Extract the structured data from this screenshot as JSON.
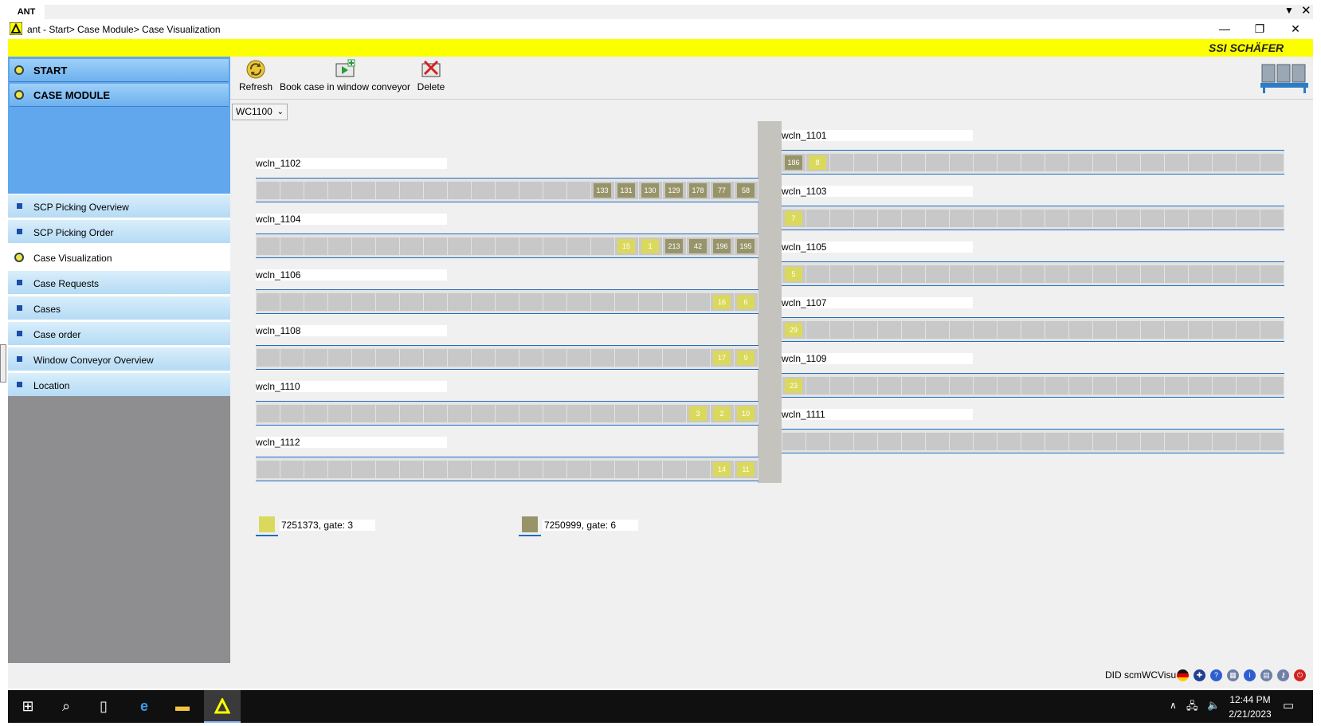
{
  "window": {
    "tab_label": "ANT",
    "title": "ant - Start> Case Module> Case Visualization",
    "menu_glyph": "▼",
    "close_glyph": "✕",
    "minimize_glyph": "—",
    "restore_glyph": "❐"
  },
  "brand": {
    "logo_prefix": "SSI",
    "logo_text": "SCHÄFER",
    "accent": "#fcff00"
  },
  "sidebar": {
    "headers": [
      {
        "label": "START"
      },
      {
        "label": "CASE MODULE"
      }
    ],
    "items": [
      {
        "label": "SCP Picking Overview",
        "active": false
      },
      {
        "label": "SCP Picking Order",
        "active": false
      },
      {
        "label": "Case Visualization",
        "active": true
      },
      {
        "label": "Case Requests",
        "active": false
      },
      {
        "label": "Cases",
        "active": false
      },
      {
        "label": "Case order",
        "active": false
      },
      {
        "label": "Window Conveyor Overview",
        "active": false
      },
      {
        "label": "Location",
        "active": false
      }
    ]
  },
  "toolbar": {
    "refresh_label": "Refresh",
    "book_label": "Book case in window conveyor",
    "delete_label": "Delete"
  },
  "selector": {
    "value": "WC1100"
  },
  "lanes": {
    "left": [
      {
        "name": "wcln_1102",
        "cases": [
          {
            "id": "133",
            "c": "g"
          },
          {
            "id": "131",
            "c": "g"
          },
          {
            "id": "130",
            "c": "g"
          },
          {
            "id": "129",
            "c": "g"
          },
          {
            "id": "178",
            "c": "g"
          },
          {
            "id": "77",
            "c": "g"
          },
          {
            "id": "58",
            "c": "g"
          }
        ]
      },
      {
        "name": "wcln_1104",
        "cases": [
          {
            "id": "15",
            "c": "y"
          },
          {
            "id": "1",
            "c": "y"
          },
          {
            "id": "213",
            "c": "g"
          },
          {
            "id": "42",
            "c": "g"
          },
          {
            "id": "196",
            "c": "g"
          },
          {
            "id": "195",
            "c": "g"
          }
        ]
      },
      {
        "name": "wcln_1106",
        "cases": [
          {
            "id": "16",
            "c": "y"
          },
          {
            "id": "6",
            "c": "y"
          }
        ]
      },
      {
        "name": "wcln_1108",
        "cases": [
          {
            "id": "17",
            "c": "y"
          },
          {
            "id": "9",
            "c": "y"
          }
        ]
      },
      {
        "name": "wcln_1110",
        "cases": [
          {
            "id": "3",
            "c": "y"
          },
          {
            "id": "2",
            "c": "y"
          },
          {
            "id": "10",
            "c": "y"
          }
        ]
      },
      {
        "name": "wcln_1112",
        "cases": [
          {
            "id": "14",
            "c": "y"
          },
          {
            "id": "11",
            "c": "y"
          }
        ]
      }
    ],
    "right": [
      {
        "name": "wcln_1101",
        "cases": [
          {
            "id": "186",
            "c": "g"
          },
          {
            "id": "8",
            "c": "y"
          }
        ]
      },
      {
        "name": "wcln_1103",
        "cases": [
          {
            "id": "7",
            "c": "y"
          }
        ]
      },
      {
        "name": "wcln_1105",
        "cases": [
          {
            "id": "5",
            "c": "y"
          }
        ]
      },
      {
        "name": "wcln_1107",
        "cases": [
          {
            "id": "29",
            "c": "y"
          }
        ]
      },
      {
        "name": "wcln_1109",
        "cases": [
          {
            "id": "23",
            "c": "y"
          }
        ]
      },
      {
        "name": "wcln_1111",
        "cases": []
      }
    ]
  },
  "legend": [
    {
      "label": "7251373, gate: 3",
      "color": "#dbd95c"
    },
    {
      "label": "7250999, gate: 6",
      "color": "#98946a"
    }
  ],
  "footer": {
    "status": "DID scmWCVisu"
  },
  "taskbar": {
    "time": "12:44 PM",
    "date": "2/21/2023"
  },
  "colors": {
    "case_yellow": "#dbd95c",
    "case_grey": "#98946a",
    "lane_line": "#1f6cc0",
    "sidebar_blue": "#61a7ee"
  }
}
